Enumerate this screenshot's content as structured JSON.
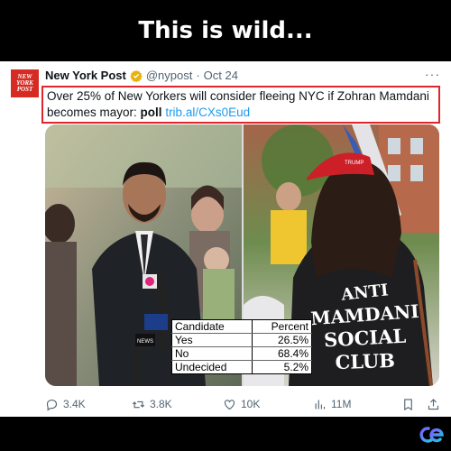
{
  "headline": "This is wild...",
  "tweet": {
    "avatar_text": [
      "NEW",
      "YORK",
      "POST"
    ],
    "author": "New York Post",
    "handle": "@nypost",
    "separator": "·",
    "date": "Oct 24",
    "text_main": "Over 25% of New Yorkers will consider fleeing NYC if Zohran Mamdani becomes mayor: ",
    "text_bold": "poll",
    "link": "trib.al/CXs0Eud",
    "more_label": "···"
  },
  "media": {
    "shirt_text": [
      "ANTI",
      "MAMDANI",
      "SOCIAL",
      "CLUB"
    ],
    "mic_label": "NEWS",
    "hat_text": "TRUMP"
  },
  "poll_table": {
    "headers": [
      "Candidate",
      "Percent"
    ],
    "rows": [
      [
        "Yes",
        "26.5%"
      ],
      [
        "No",
        "68.4%"
      ],
      [
        "Undecided",
        "5.2%"
      ]
    ]
  },
  "actions": {
    "replies": "3.4K",
    "reposts": "3.8K",
    "likes": "10K",
    "views": "11M"
  },
  "icons": {
    "reply": "reply-icon",
    "repost": "repost-icon",
    "like": "heart-icon",
    "views": "views-icon",
    "bookmark": "bookmark-icon",
    "share": "share-icon",
    "verified": "verified-badge-icon",
    "brand": "brand-logo-icon"
  },
  "colors": {
    "highlight_box": "#e0252d",
    "link": "#1d9bf0",
    "verified": "#e8b30f",
    "avatar": "#d62b22"
  }
}
